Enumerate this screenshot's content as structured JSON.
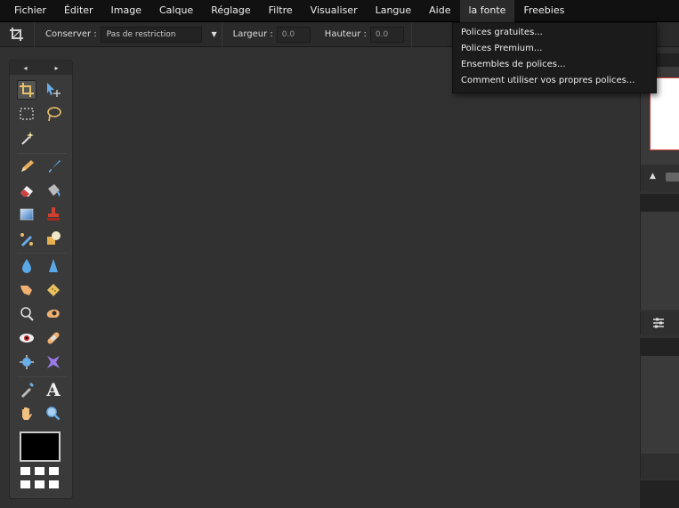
{
  "menubar": {
    "items": [
      "Fichier",
      "Éditer",
      "Image",
      "Calque",
      "Réglage",
      "Filtre",
      "Visualiser",
      "Langue",
      "Aide",
      "la fonte",
      "Freebies"
    ]
  },
  "optionsbar": {
    "keep_label": "Conserver :",
    "keep_value": "Pas de restriction",
    "width_label": "Largeur :",
    "width_value": "0.0",
    "height_label": "Hauteur :",
    "height_value": "0.0"
  },
  "font_menu": {
    "items": [
      "Polices gratuites...",
      "Polices Premium...",
      "Ensembles de polices...",
      "Comment utiliser vos propres polices..."
    ]
  },
  "toolbox": {
    "header_left": "◂",
    "header_right": "▸",
    "tools": [
      "crop-icon",
      "move-icon",
      "marquee-icon",
      "lasso-icon",
      "magic-wand-icon",
      "pencil-icon",
      "brush-icon",
      "eraser-icon",
      "paint-bucket-icon",
      "gradient-icon",
      "clone-stamp-icon",
      "color-replace-icon",
      "drawing-shapes-icon",
      "blur-icon",
      "sharpen-icon",
      "smudge-icon",
      "sponge-icon",
      "dodge-icon",
      "burn-icon",
      "red-eye-icon",
      "spot-heal-icon",
      "bloat-icon",
      "pinch-icon",
      "color-picker-icon",
      "type-icon",
      "hand-icon",
      "zoom-icon"
    ],
    "text_tool_glyph": "A",
    "foreground_color": "#000000"
  },
  "colors": {
    "menubar_bg": "#111111",
    "workspace_bg": "#313131",
    "panel_bg": "#3a3a3a"
  }
}
